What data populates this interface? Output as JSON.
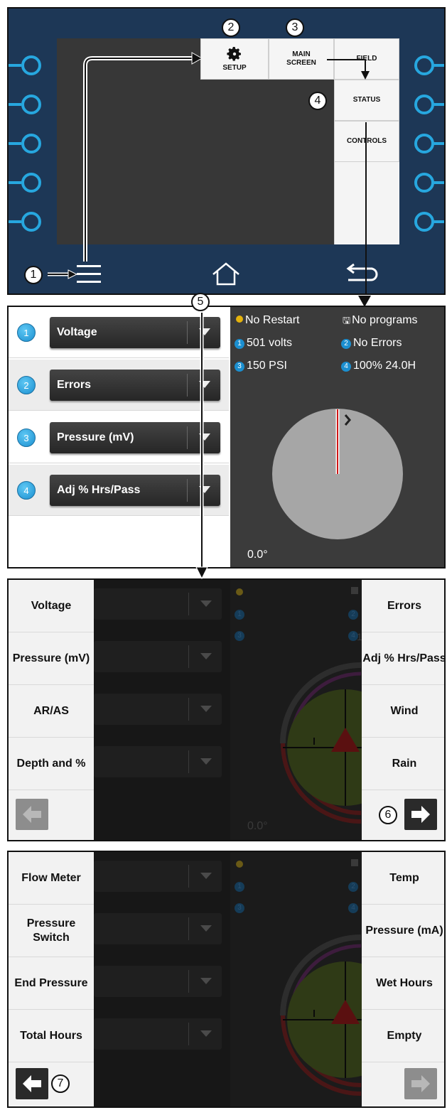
{
  "panel1": {
    "menu": {
      "setup": "SETUP",
      "main_screen_line1": "MAIN",
      "main_screen_line2": "SCREEN",
      "field": "FIELD",
      "status": "STATUS",
      "controls": "CONTROLS"
    },
    "icons": {
      "gear": "gear-icon",
      "menu": "hamburger-icon",
      "home": "home-icon",
      "back": "back-arrow-icon"
    },
    "callouts": [
      "1",
      "2",
      "3",
      "4",
      "5",
      "6",
      "7"
    ]
  },
  "panel2": {
    "rows": [
      {
        "num": "1",
        "label": "Voltage"
      },
      {
        "num": "2",
        "label": "Errors"
      },
      {
        "num": "3",
        "label": "Pressure (mV)"
      },
      {
        "num": "4",
        "label": "Adj % Hrs/Pass"
      }
    ],
    "status": {
      "restart": "No Restart",
      "programs": "No programs",
      "s1_num": "1",
      "s1": "501 volts",
      "s2_num": "2",
      "s2": "No Errors",
      "s3_num": "3",
      "s3": "150 PSI",
      "s4_num": "4",
      "s4": "100% 24.0H"
    },
    "angle": "0.0°"
  },
  "panel3": {
    "left": [
      "Voltage",
      "Pressure (mV)",
      "AR/AS",
      "Depth and %"
    ],
    "right": [
      "Errors",
      "Adj % Hrs/Pass",
      "Wind",
      "Rain"
    ],
    "angle": "0.0°",
    "dim_status": {
      "n1": "1",
      "n2": "2",
      "n3": "3",
      "n4": "4",
      "partial": "1"
    }
  },
  "panel4": {
    "left": [
      "Flow Meter",
      "Pressure Switch",
      "End Pressure",
      "Total Hours"
    ],
    "right": [
      "Temp",
      "Pressure (mA)",
      "Wet Hours",
      "Empty"
    ],
    "dim_status": {
      "n1": "1",
      "n2": "2",
      "n3": "3",
      "n4": "4"
    }
  },
  "colors": {
    "blue": "#27a7df",
    "navy": "#1d3756",
    "green": "#8db33b",
    "red": "#c92020"
  }
}
